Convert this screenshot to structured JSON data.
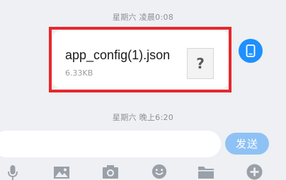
{
  "chat": {
    "timestamp_top": "星期六 凌晨0:08",
    "timestamp_mid": "星期六 晚上6:20",
    "file_message": {
      "file_name": "app_config(1).json",
      "file_size": "6.33KB",
      "file_icon_glyph": "?"
    },
    "highlight_color": "#e8272b",
    "avatar_icon": "phone-icon",
    "avatar_color": "#1e90ff"
  },
  "composer": {
    "input_value": "",
    "send_label": "发送",
    "send_color": "#8ec2f5"
  },
  "toolbar": {
    "icons": [
      "microphone-icon",
      "image-icon",
      "camera-icon",
      "emoji-icon",
      "folder-icon",
      "plus-icon"
    ]
  }
}
